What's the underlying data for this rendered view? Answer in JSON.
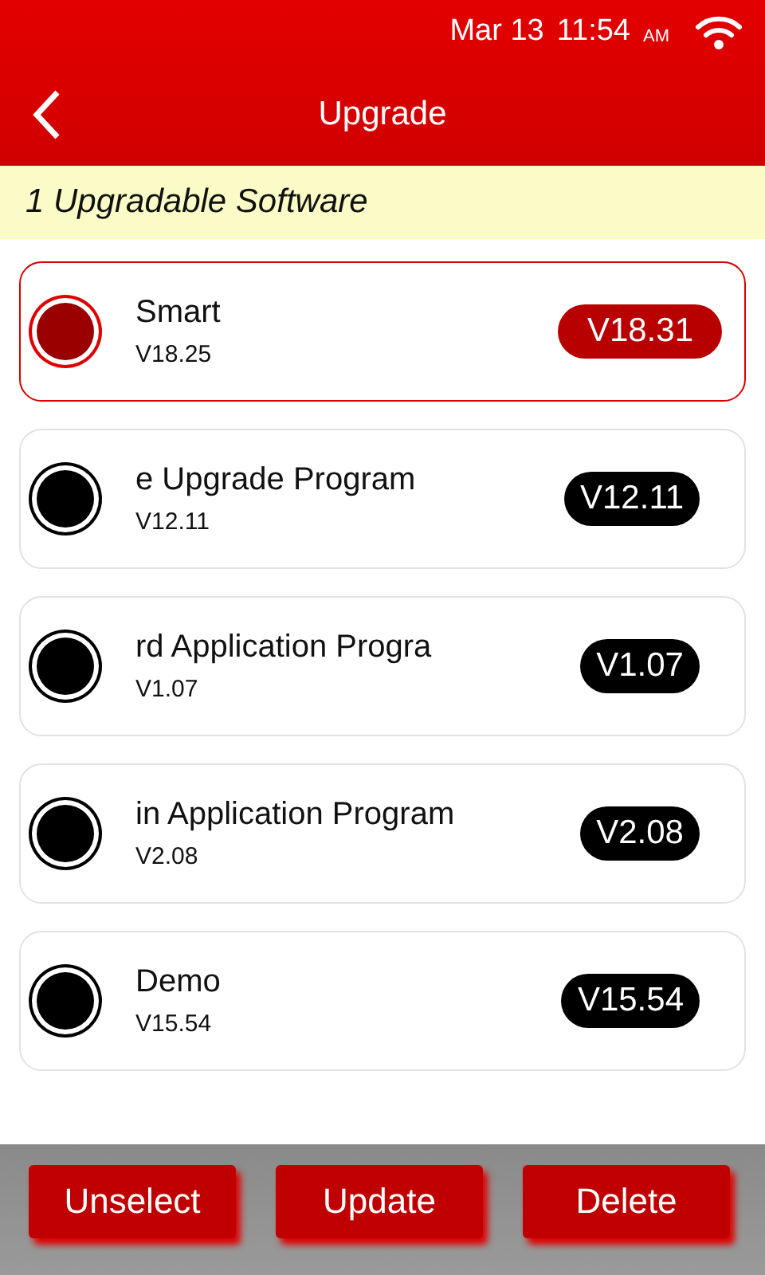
{
  "status_bar": {
    "date": "Mar 13",
    "time": "11:54",
    "ampm": "AM"
  },
  "header": {
    "title": "Upgrade"
  },
  "banner": "1 Upgradable Software",
  "items": [
    {
      "name": "Smart",
      "current": "V18.25",
      "available": "V18.31",
      "selected": true
    },
    {
      "name": "e Upgrade Program",
      "current": "V12.11",
      "available": "V12.11",
      "selected": false
    },
    {
      "name": "rd Application Progra",
      "current": "V1.07",
      "available": "V1.07",
      "selected": false
    },
    {
      "name": "in Application Program",
      "current": "V2.08",
      "available": "V2.08",
      "selected": false
    },
    {
      "name": "Demo",
      "current": "V15.54",
      "available": "V15.54",
      "selected": false
    }
  ],
  "buttons": [
    "Unselect",
    "Update",
    "Delete"
  ]
}
